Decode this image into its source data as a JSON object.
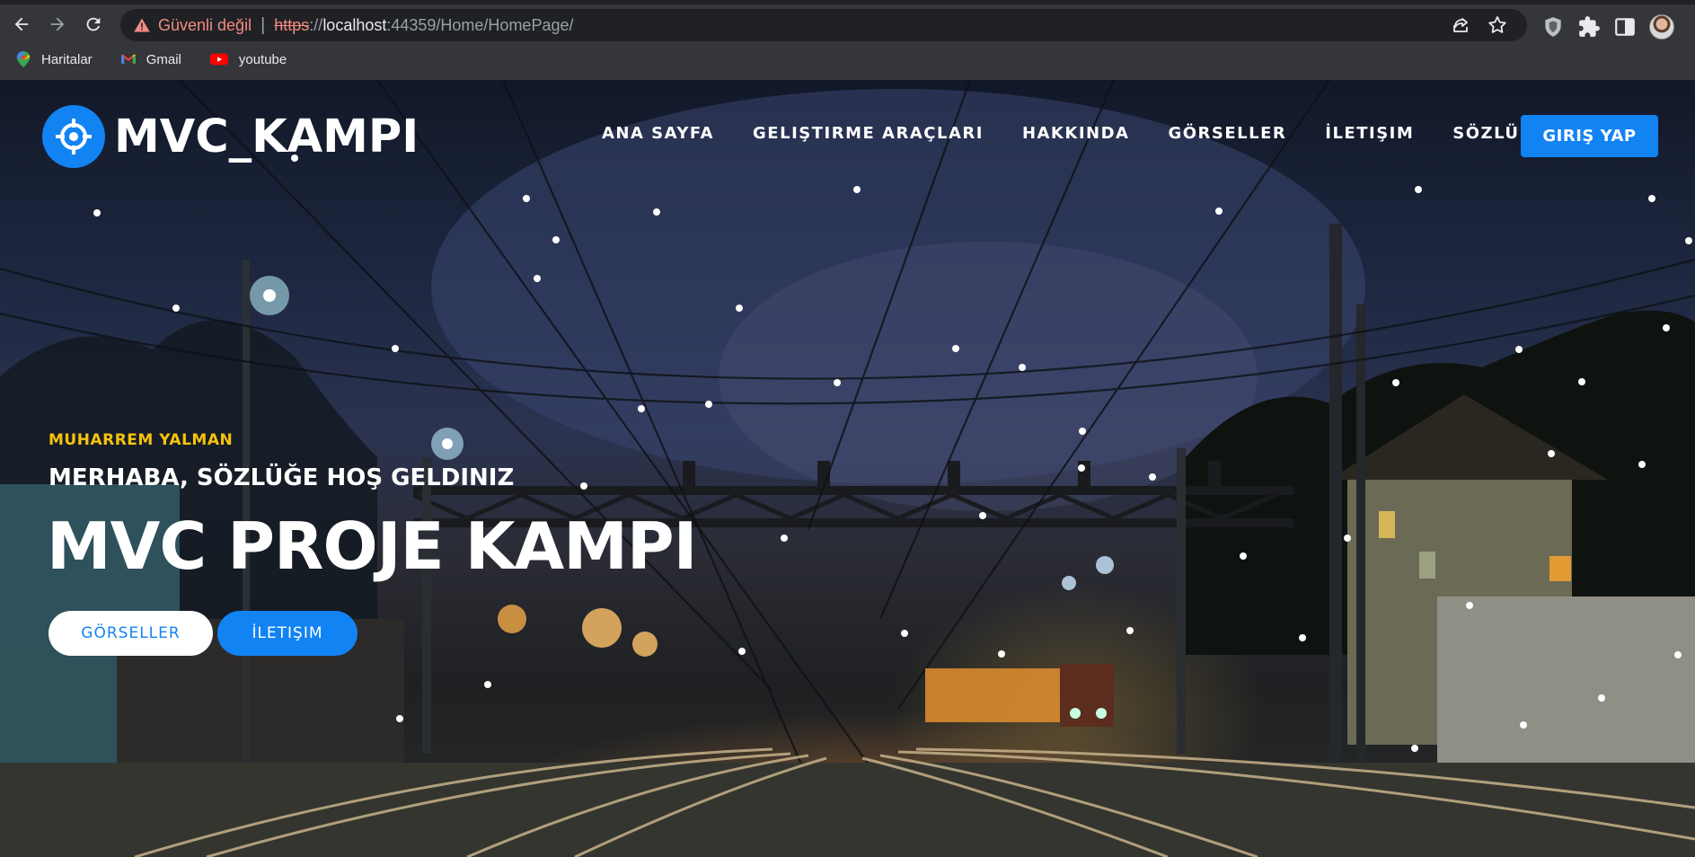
{
  "browser": {
    "security_label": "Güvenli değil",
    "separator": "|",
    "url_scheme": "https",
    "url_sep": "://",
    "url_host": "localhost",
    "url_rest": ":44359/Home/HomePage/",
    "bookmarks": [
      {
        "label": "Haritalar",
        "icon": "maps-icon"
      },
      {
        "label": "Gmail",
        "icon": "gmail-icon"
      },
      {
        "label": "youtube",
        "icon": "youtube-icon"
      }
    ]
  },
  "site": {
    "brand": "MVC_KAMPI",
    "menu": [
      "ANA SAYFA",
      "GELIŞTIRME ARAÇLARI",
      "HAKKINDA",
      "GÖRSELLER",
      "İLETIŞIM",
      "SÖZLÜK"
    ],
    "login": "GIRIŞ YAP",
    "accent_color": "#1283f3",
    "highlight_color": "#f8c30b"
  },
  "hero": {
    "subtitle": "MUHARREM YALMAN",
    "welcome": "MERHABA, SÖZLÜĞE HOŞ GELDINIZ",
    "title": "MVC PROJE KAMPI",
    "button_primary": "GÖRSELLER",
    "button_secondary": "İLETIŞIM"
  }
}
